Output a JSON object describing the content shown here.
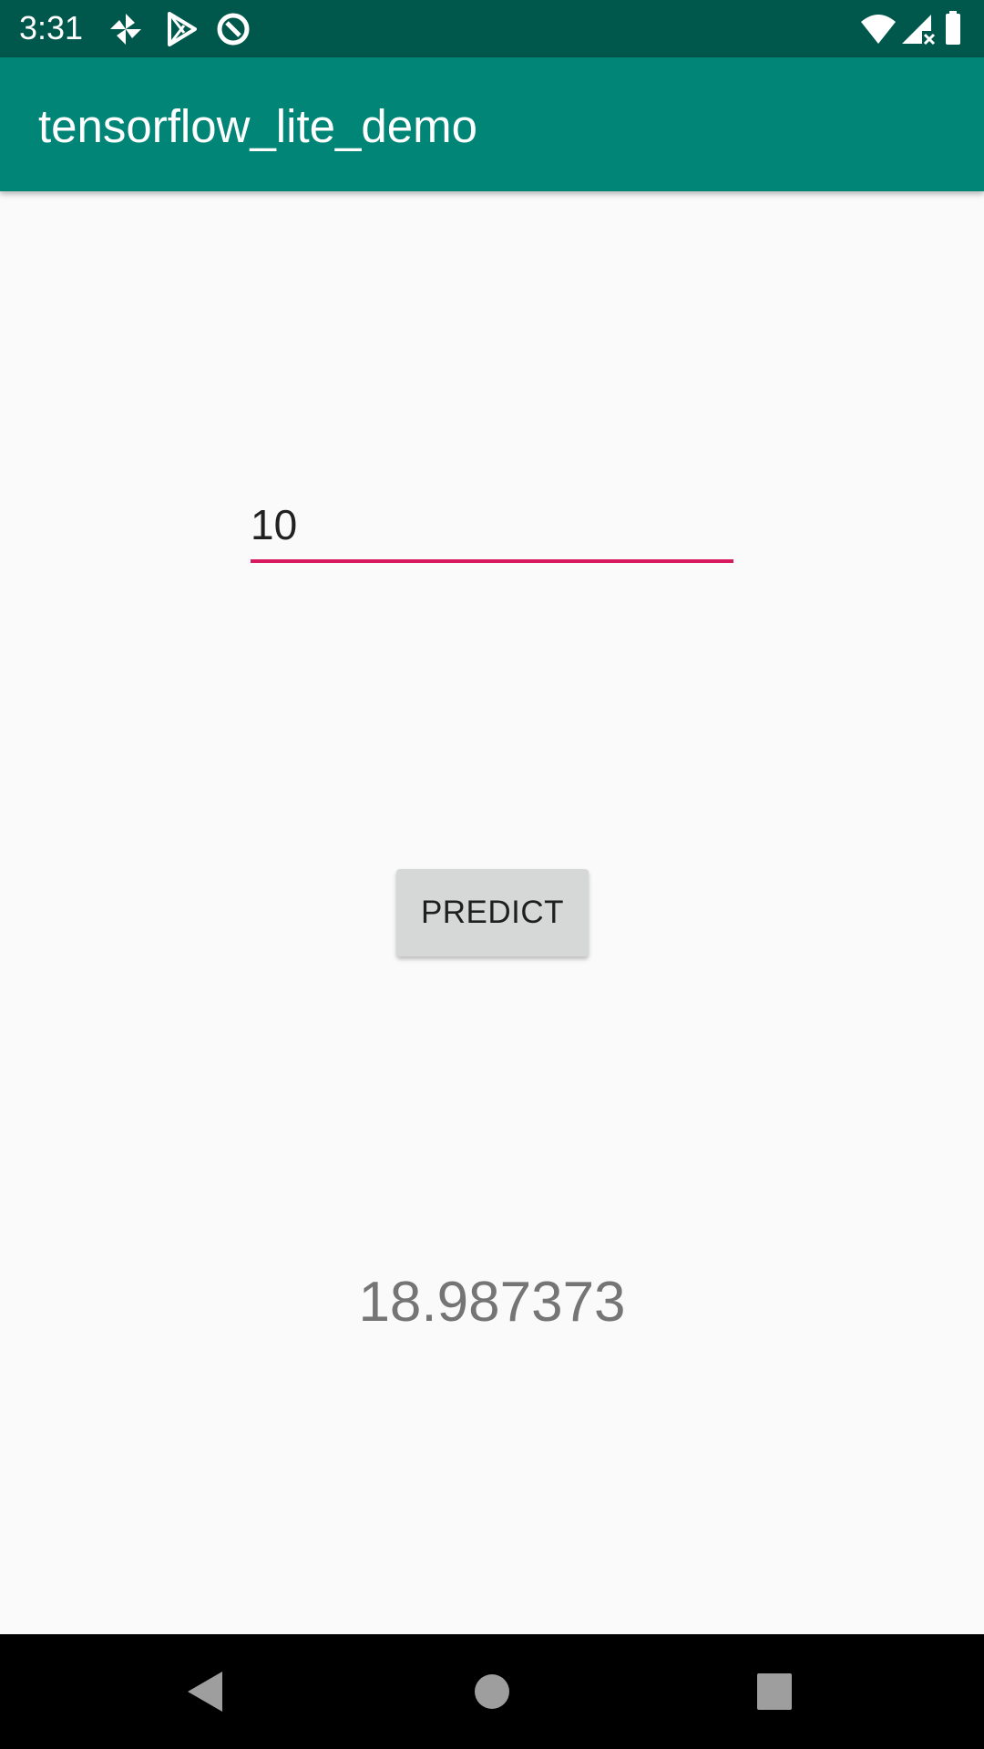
{
  "status_bar": {
    "time": "3:31",
    "left_icons": [
      "pinwheel-icon",
      "play-store-icon",
      "data-saver-icon"
    ],
    "right_icons": [
      "wifi-icon",
      "signal-no-data-icon",
      "battery-icon"
    ]
  },
  "app_bar": {
    "title": "tensorflow_lite_demo"
  },
  "form": {
    "input_value": "10",
    "button_label": "PREDICT"
  },
  "result": {
    "value": "18.987373"
  },
  "nav_bar": {
    "buttons": [
      "back-icon",
      "home-icon",
      "recents-icon"
    ]
  },
  "colors": {
    "status_bar": "#00574b",
    "app_bar": "#008577",
    "accent": "#d81b60",
    "background": "#fafafa",
    "button": "#d6d7d7",
    "result_text": "#757575"
  }
}
